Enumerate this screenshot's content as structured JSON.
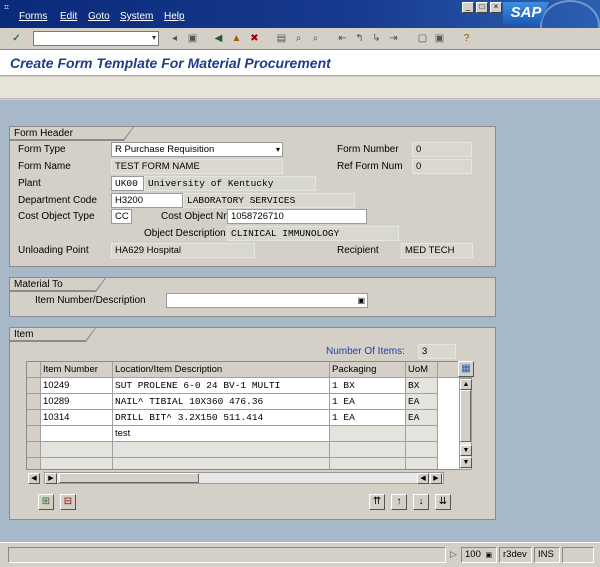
{
  "menu": {
    "items": [
      "Forms",
      "Edit",
      "Goto",
      "System",
      "Help"
    ],
    "logo": "SAP"
  },
  "toolbar": {
    "command_field": "",
    "icons": [
      "enter-icon",
      "back-icon",
      "save-icon",
      "exit-icon",
      "cancel-icon",
      "print-icon",
      "find-icon",
      "find-next-icon",
      "first-page-icon",
      "prev-page-icon",
      "next-page-icon",
      "last-page-icon",
      "new-session-icon",
      "shortcut-icon",
      "help-icon"
    ]
  },
  "screen": {
    "title": "Create Form Template For Material Procurement"
  },
  "form_header": {
    "group_title": "Form Header Information",
    "form_type_label": "Form Type",
    "form_type_value": "R Purchase Requisition",
    "form_number_label": "Form Number",
    "form_number_value": "0",
    "form_name_label": "Form Name",
    "form_name_value": "TEST FORM NAME",
    "ref_form_num_label": "Ref Form Num",
    "ref_form_num_value": "0",
    "plant_label": "Plant",
    "plant_code": "UK00",
    "plant_name": "University of Kentucky",
    "department_code_label": "Department Code",
    "department_code": "H3200",
    "department_name": "LABORATORY SERVICES",
    "cost_object_type_label": "Cost Object Type",
    "cost_object_type_value": "CC",
    "cost_object_nr_label": "Cost Object Nr",
    "cost_object_nr_value": "1058726710",
    "object_description_label": "Object Description",
    "object_description_value": "CLINICAL IMMUNOLOGY",
    "unloading_point_label": "Unloading Point",
    "unloading_point_value": "HA629 Hospital",
    "recipient_label": "Recipient",
    "recipient_value": "MED TECH"
  },
  "material": {
    "group_title": "Material To Insert",
    "item_label": "Item Number/Description",
    "item_value": ""
  },
  "items": {
    "group_title": "Item Information",
    "count_label": "Number Of Items:",
    "count_value": "3",
    "columns": [
      "Item Number",
      "Location/Item Description",
      "Packaging",
      "UoM"
    ],
    "rows": [
      [
        "10249",
        "SUT PROLENE 6-0 24 BV-1 MULTI",
        "1 BX",
        "BX"
      ],
      [
        "10289",
        "NAIL^ TIBIAL 10X360 476.36",
        "1 EA",
        "EA"
      ],
      [
        "10314",
        "DRILL BIT^ 3.2X150 511.414",
        "1 EA",
        "EA"
      ],
      [
        "",
        "test",
        "",
        ""
      ],
      [
        "",
        "",
        "",
        ""
      ],
      [
        "",
        "",
        "",
        ""
      ]
    ]
  },
  "status": {
    "zoom": "100",
    "system": "r3dev",
    "mode": "INS"
  },
  "colors": {
    "title_blue": "#1f3d8a",
    "work_area": "#a7b8c9",
    "menu_bar": "#173b8f"
  }
}
